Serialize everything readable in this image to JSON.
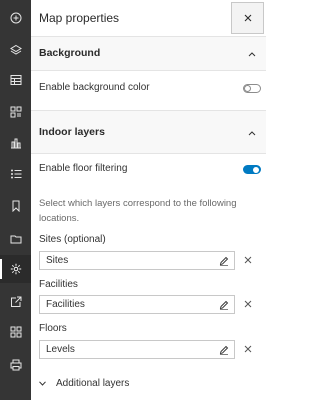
{
  "rail": {
    "items": [
      {
        "name": "add-icon",
        "active": false
      },
      {
        "name": "layers-icon",
        "active": false
      },
      {
        "name": "table-icon",
        "active": false
      },
      {
        "name": "widgets-icon",
        "active": false
      },
      {
        "name": "chart-icon",
        "active": false
      },
      {
        "name": "legend-icon",
        "active": false
      },
      {
        "name": "bookmark-icon",
        "active": false
      },
      {
        "name": "folder-icon",
        "active": false
      },
      {
        "name": "gear-icon",
        "active": true
      },
      {
        "name": "share-icon",
        "active": false
      },
      {
        "name": "apps-icon",
        "active": false
      },
      {
        "name": "print-icon",
        "active": false
      }
    ]
  },
  "panel": {
    "title": "Map properties"
  },
  "background": {
    "title": "Background",
    "enable_label": "Enable background color",
    "enabled": false
  },
  "indoor": {
    "title": "Indoor layers",
    "filter_label": "Enable floor filtering",
    "filter_enabled": true,
    "help": "Select which layers correspond to the following locations.",
    "sites_label": "Sites (optional)",
    "sites_value": "Sites",
    "facilities_label": "Facilities",
    "facilities_value": "Facilities",
    "floors_label": "Floors",
    "floors_value": "Levels",
    "additional_label": "Additional layers"
  },
  "colors": {
    "rail": "#353535",
    "accent": "#007ac2"
  }
}
